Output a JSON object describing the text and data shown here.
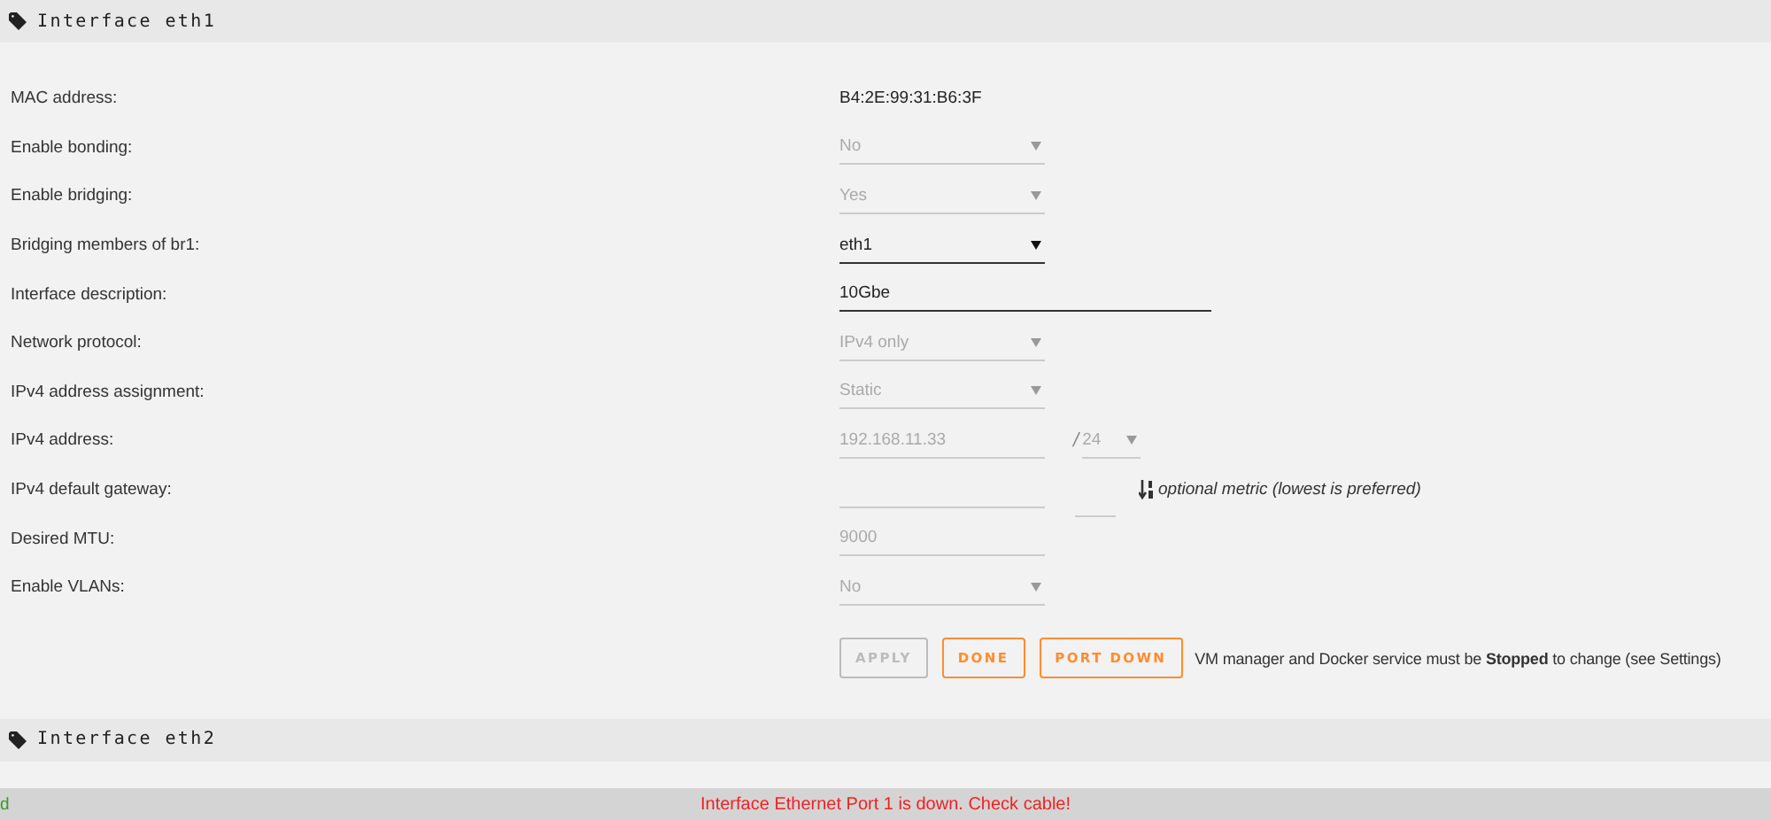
{
  "sections": [
    {
      "title": "Interface eth1"
    },
    {
      "title": "Interface eth2"
    }
  ],
  "rows": [
    {
      "label": "MAC address:",
      "kind": "text",
      "value": "B4:2E:99:31:B6:3F"
    },
    {
      "label": "Enable bonding:",
      "kind": "select",
      "value": "No",
      "disabled": true
    },
    {
      "label": "Enable bridging:",
      "kind": "select",
      "value": "Yes",
      "disabled": true
    },
    {
      "label": "Bridging members of br1:",
      "kind": "select",
      "value": "eth1",
      "disabled": false
    },
    {
      "label": "Interface description:",
      "kind": "input",
      "value": "10Gbe",
      "disabled": false,
      "wide": true
    },
    {
      "label": "Network protocol:",
      "kind": "select",
      "value": "IPv4 only",
      "disabled": true
    },
    {
      "label": "IPv4 address assignment:",
      "kind": "select",
      "value": "Static",
      "disabled": true
    },
    {
      "label": "IPv4 address:",
      "kind": "ip",
      "value": "192.168.11.33",
      "separator": "/",
      "prefix": "24",
      "disabled": true
    },
    {
      "label": "IPv4 default gateway:",
      "kind": "gateway",
      "note": "optional metric (lowest is preferred)",
      "disabled": true
    },
    {
      "label": "Desired MTU:",
      "kind": "input",
      "value": "9000",
      "disabled": true,
      "wide": false
    },
    {
      "label": "Enable VLANs:",
      "kind": "select",
      "value": "No",
      "disabled": true
    }
  ],
  "buttons": [
    {
      "label": "APPLY",
      "disabled": true
    },
    {
      "label": "DONE",
      "disabled": false
    },
    {
      "label": "PORT DOWN",
      "disabled": false
    }
  ],
  "notice": "VM manager and Docker service must be **Stopped** to change (see Settings)",
  "status_bar": {
    "left": "d",
    "message": "Interface Ethernet Port 1 is down. Check cable!"
  }
}
